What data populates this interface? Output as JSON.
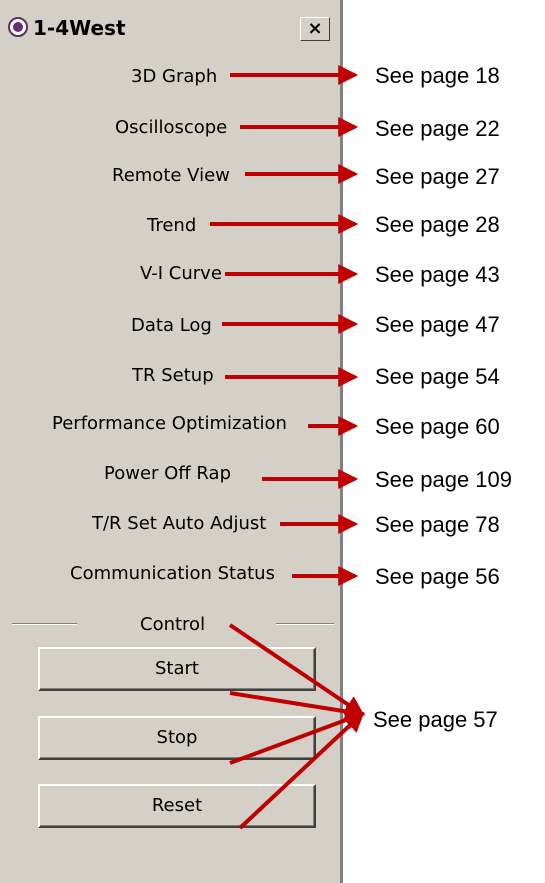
{
  "window": {
    "title": "1-4West",
    "close_label": "×"
  },
  "menu": [
    {
      "label": "3D Graph",
      "ref": "See page 18"
    },
    {
      "label": "Oscilloscope",
      "ref": "See page 22"
    },
    {
      "label": "Remote View",
      "ref": "See page 27"
    },
    {
      "label": "Trend",
      "ref": "See page 28"
    },
    {
      "label": "V-I Curve",
      "ref": "See page 43"
    },
    {
      "label": "Data Log",
      "ref": "See page 47"
    },
    {
      "label": "TR Setup",
      "ref": "See page 54"
    },
    {
      "label": "Performance Optimization",
      "ref": "See page 60"
    },
    {
      "label": "Power Off Rap",
      "ref": "See page 109"
    },
    {
      "label": "T/R Set Auto Adjust",
      "ref": "See page 78"
    },
    {
      "label": "Communication Status",
      "ref": "See page 56"
    }
  ],
  "control": {
    "label": "Control",
    "buttons": [
      "Start",
      "Stop",
      "Reset"
    ],
    "ref": "See page 57"
  },
  "colors": {
    "window_bg": "#d4d0c8",
    "arrow": "#c00000"
  }
}
